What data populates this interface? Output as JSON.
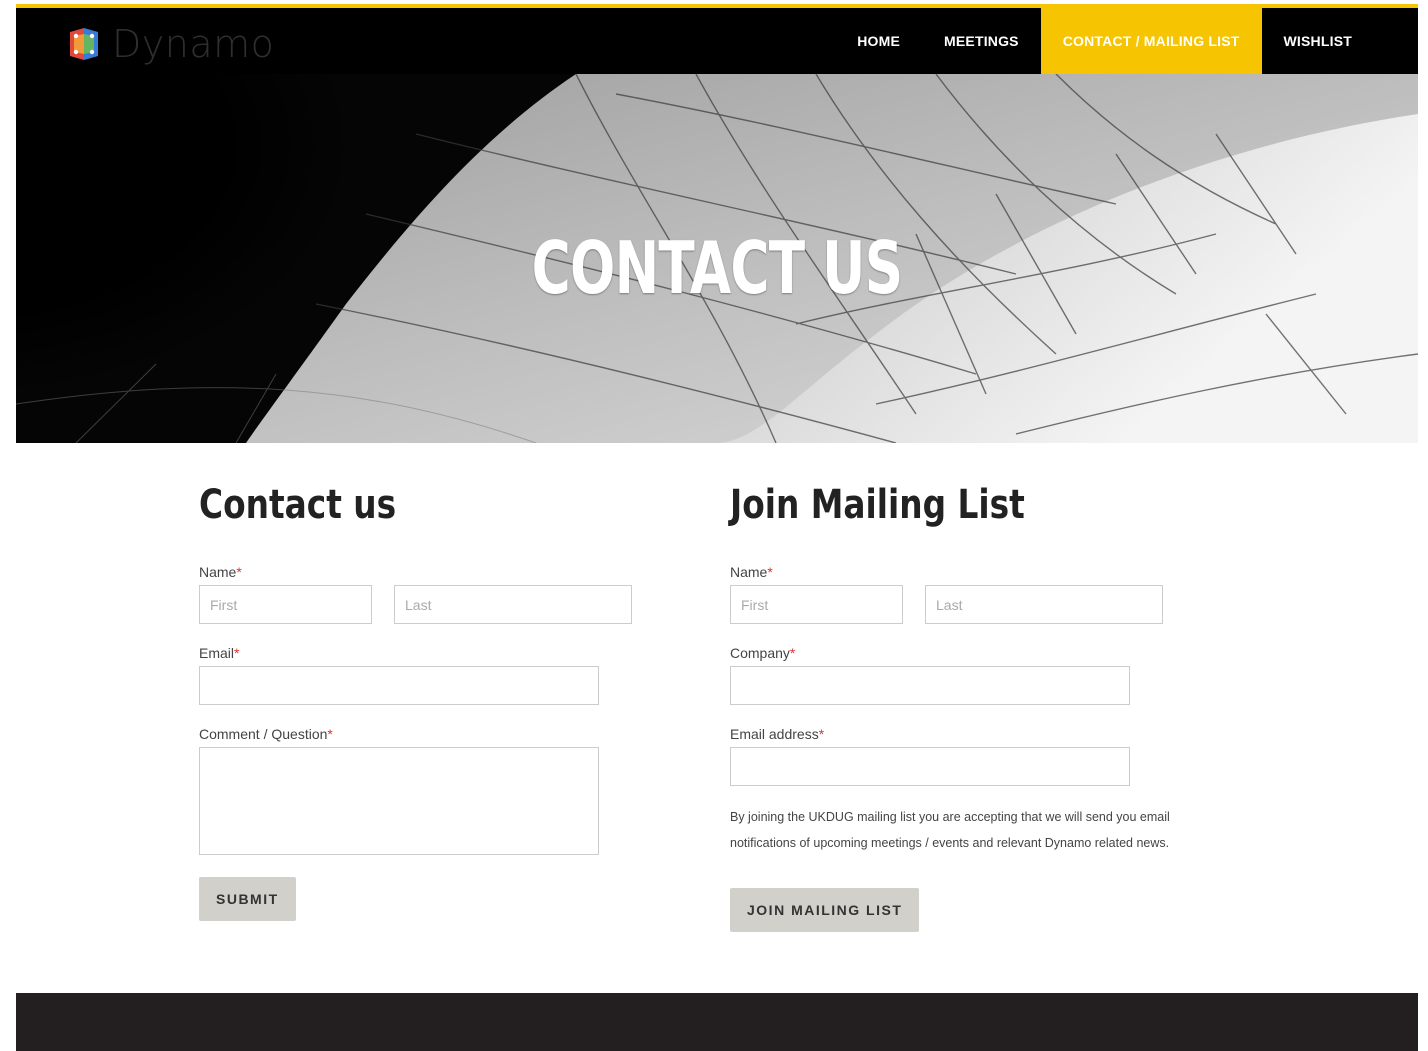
{
  "brand": {
    "name": "Dynamo"
  },
  "nav": {
    "items": [
      {
        "label": "HOME",
        "active": false
      },
      {
        "label": "MEETINGS",
        "active": false
      },
      {
        "label": "CONTACT / MAILING LIST",
        "active": true
      },
      {
        "label": "WISHLIST",
        "active": false
      }
    ]
  },
  "hero": {
    "title": "CONTACT US"
  },
  "contact_form": {
    "title": "Contact us",
    "name_label": "Name",
    "first_placeholder": "First",
    "last_placeholder": "Last",
    "email_label": "Email",
    "comment_label": "Comment / Question",
    "submit_label": "SUBMIT"
  },
  "mailing_form": {
    "title": "Join Mailing List",
    "name_label": "Name",
    "first_placeholder": "First",
    "last_placeholder": "Last",
    "company_label": "Company",
    "email_label": "Email address",
    "note": "By joining the UKDUG mailing list you are accepting that we will send you email notifications of upcoming meetings / events and relevant Dynamo related news.",
    "submit_label": "JOIN MAILING LIST"
  },
  "colors": {
    "accent": "#f6c400",
    "nav_bg": "#000000",
    "button_bg": "#d2d0cb",
    "footer_bg": "#231f20",
    "required": "#dd3333"
  }
}
